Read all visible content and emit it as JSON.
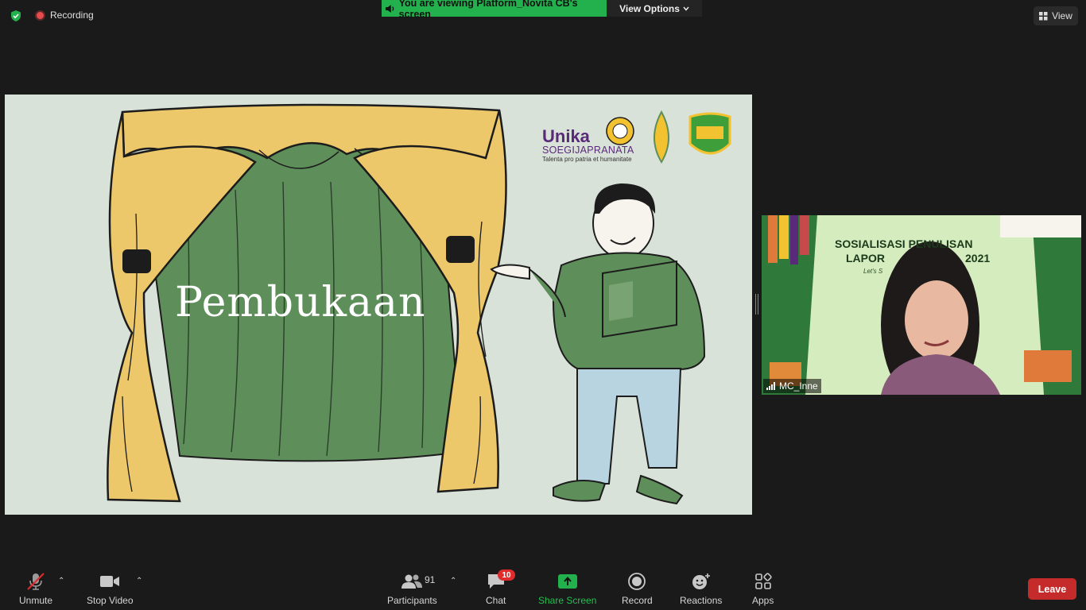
{
  "topbar": {
    "recording_label": "Recording",
    "share_banner": "You are viewing Platform_Novita CB's screen",
    "view_options_label": "View Options",
    "view_label": "View"
  },
  "slide": {
    "title": "Pembukaan",
    "logo_name": "Unika",
    "logo_university": "SOEGIJAPRANATA",
    "logo_motto": "Talenta pro patria et humanitate"
  },
  "video": {
    "participant_name": "MC_Inne",
    "background_line1": "SOSIALISASI PENULISAN",
    "background_line2a": "LAPOR",
    "background_line2b": "2021",
    "background_line3": "Let's S"
  },
  "toolbar": {
    "unmute_label": "Unmute",
    "stop_video_label": "Stop Video",
    "participants_label": "Participants",
    "participants_count": "91",
    "chat_label": "Chat",
    "chat_badge": "10",
    "share_screen_label": "Share Screen",
    "record_label": "Record",
    "reactions_label": "Reactions",
    "apps_label": "Apps",
    "leave_label": "Leave"
  },
  "colors": {
    "share_green": "#23b14d",
    "leave_red": "#c62b2b",
    "slide_bg": "#d9e2d9",
    "curtain_green": "#5e8f5a",
    "curtain_yellow": "#edc86a"
  }
}
